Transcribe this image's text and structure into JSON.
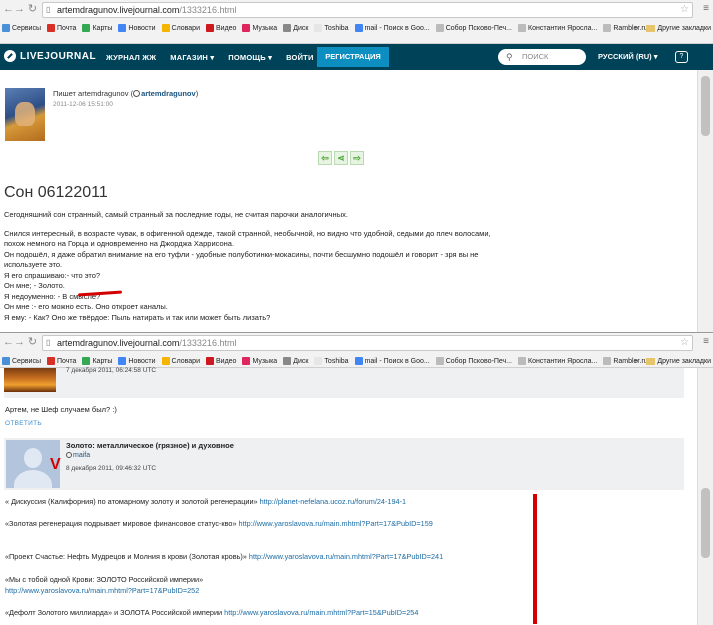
{
  "browser_top": {
    "url_host": "artemdragunov.livejournal.com",
    "url_path": "/1333216.html",
    "bookmarks": [
      {
        "label": "Сервисы",
        "color": "#4a90d9"
      },
      {
        "label": "Почта",
        "color": "#d93025"
      },
      {
        "label": "Карты",
        "color": "#34a853"
      },
      {
        "label": "Новости",
        "color": "#4285f4"
      },
      {
        "label": "Словари",
        "color": "#f4b400"
      },
      {
        "label": "Видео",
        "color": "#cc181e"
      },
      {
        "label": "Музыка",
        "color": "#e0245e"
      },
      {
        "label": "Диск",
        "color": "#888888"
      },
      {
        "label": "Toshiba",
        "color": "#e6e6e6"
      },
      {
        "label": "mail - Поиск в Goo...",
        "color": "#4285f4"
      },
      {
        "label": "Собор Псково-Печ...",
        "color": "#bbbbbb"
      },
      {
        "label": "Константин Яросла...",
        "color": "#bbbbbb"
      },
      {
        "label": "Rambler.ru",
        "color": "#bbbbbb"
      }
    ],
    "more": "»",
    "other_bookmarks": "Другие закладки"
  },
  "browser_bottom": {
    "url_host": "artemdragunov.livejournal.com",
    "url_path": "/1333216.html"
  },
  "lj_header": {
    "logo": "LIVEJOURNAL",
    "nav": [
      "ЖУРНАЛ ЖЖ",
      "МАГАЗИН",
      "ПОМОЩЬ",
      "ВОЙТИ"
    ],
    "register": "РЕГИСТРАЦИЯ",
    "search_placeholder": "ПОИСК",
    "language": "РУССКИЙ (RU)",
    "help_icon": "?"
  },
  "post": {
    "byline_prefix": "Пишет artemdragunov (",
    "byline_user": "artemdragunov",
    "byline_suffix": ")",
    "date": "2011-12-06 15:51:00",
    "title": "Сон 06122011",
    "paragraphs": [
      "Сегодняшний сон странный, самый странный за последние годы, не считая парочки аналогичных.",
      "",
      "Снился интересный, в возрасте чувак, в офигенной одежде, такой странной, необычной, но видно что удобной,  седыми до плеч волосами,",
      "похож немного на Горца и одновременно на Джорджа Харрисона.",
      "Он подошёл, я даже обратил внимание на его туфли - удобные полуботинки-мокасины, почти бесшумно подошёл и говорит - зря вы не",
      "используете это.",
      "Я его спрашиваю:- что это?",
      "Он мне; - Золото.",
      "Я недоуменно: - В смысле?",
      "Он мне :- его можно есть. Оно откроет каналы.",
      "Я ему: - Как? Оно же твёрдое: Пыль натирать и так или может быть лизать?"
    ]
  },
  "comment1": {
    "date": "7 декабря 2011, 06:24:58 UTC",
    "text": "Артем, не Шеф случаем был? :)",
    "reply": "ОТВЕТИТЬ"
  },
  "comment2": {
    "title": "Золото: металлическое (грязное) и духовное",
    "user": "maifa",
    "date": "8 декабря 2011, 09:46:32 UTC",
    "lines": [
      {
        "text": "« Дискуссия (Калифорния) по атомарному золоту и золотой регенерации» ",
        "link": "http://planet-nefelana.ucoz.ru/forum/24-194-1"
      },
      {
        "text": "«Золотая регенерация подрывает мировое финансовое статус-кво» ",
        "link": "http://www.yaroslavova.ru/main.mhtml?Part=17&PubID=159"
      },
      {
        "text": "«Проект Счастье: Нефть Мудрецов и Молния в крови (Золотая кровь)» ",
        "link": "http://www.yaroslavova.ru/main.mhtml?Part=17&PubID=241"
      },
      {
        "text": "«Мы с тобой одной Крови: ЗОЛОТО Российской империи»",
        "link": ""
      },
      {
        "text": "",
        "link": "http://www.yaroslavova.ru/main.mhtml?Part=17&PubID=252"
      },
      {
        "text": "«Дефолт Золотого миллиарда» и ЗОЛОТА Российской империи ",
        "link": "http://www.yaroslavova.ru/main.mhtml?Part=15&PubID=254"
      }
    ]
  }
}
